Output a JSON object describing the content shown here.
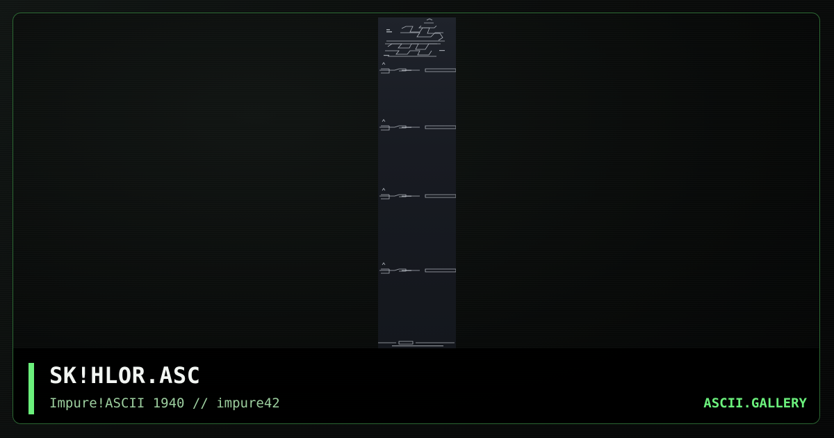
{
  "card": {
    "title": "SK!HLOR.ASC",
    "subtitle": "Impure!ASCII 1940 // impure42",
    "brand": "ASCII.GALLERY"
  },
  "colors": {
    "accent": "#6bf07c",
    "frame_border": "#2d6a34",
    "subtitle_text": "#9dcf9f",
    "title_text": "#f2f5f2",
    "preview_background": "#1f232b"
  }
}
